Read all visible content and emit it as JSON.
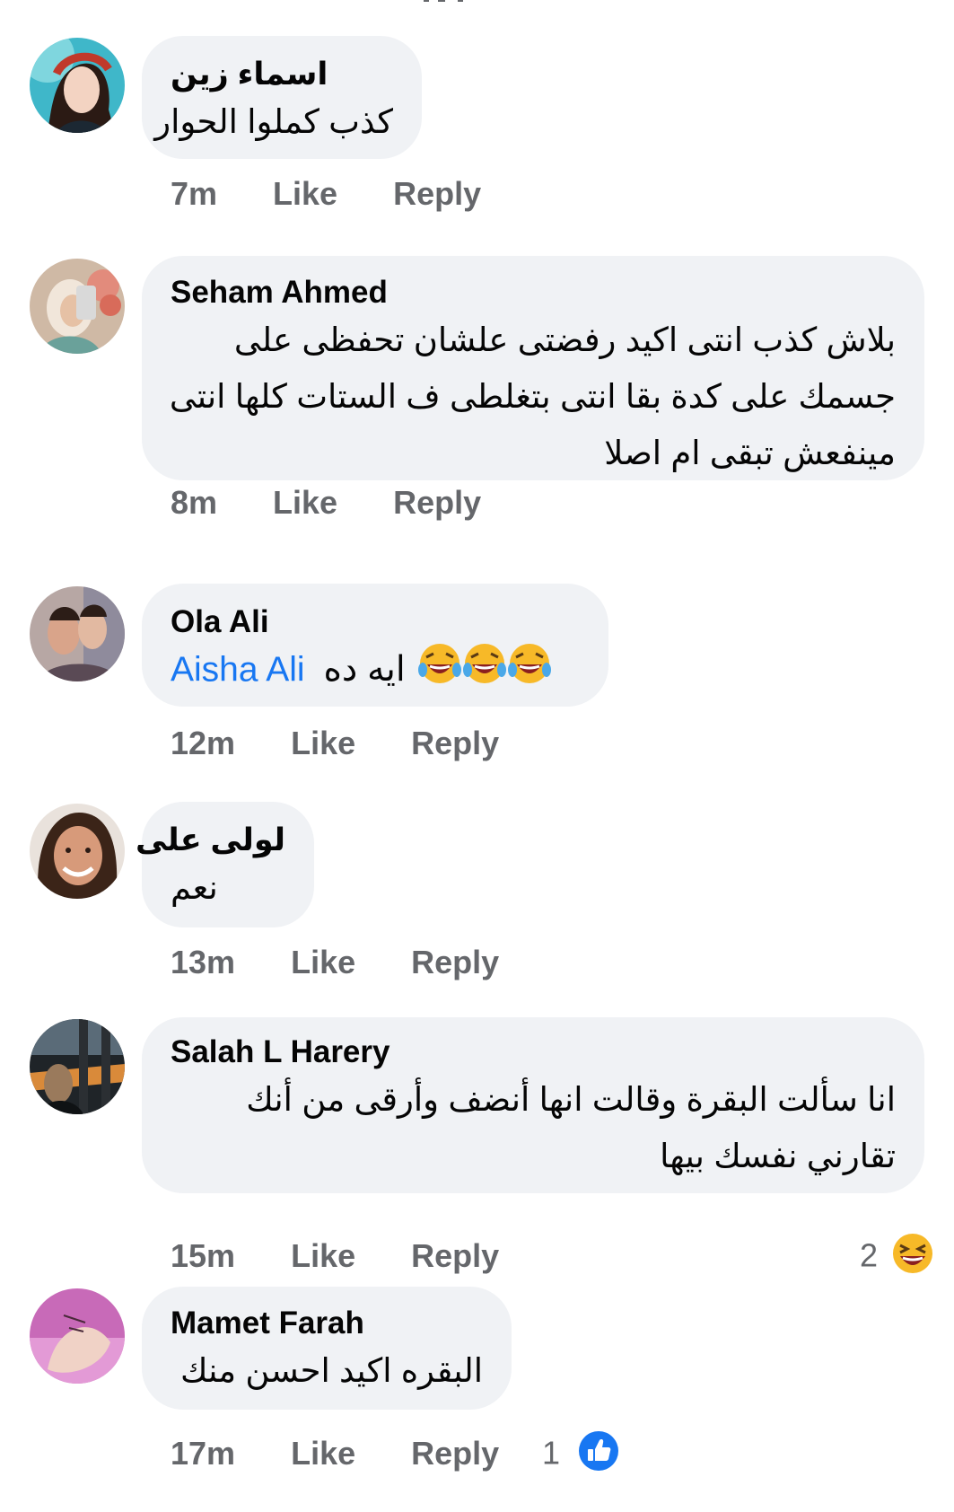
{
  "comments": [
    {
      "author": "اسماء زين",
      "lines": [
        "كذب كملوا الحوار"
      ],
      "time": "7m",
      "like": "Like",
      "reply": "Reply"
    },
    {
      "author": "Seham Ahmed",
      "lines": [
        "بلاش كذب انتى اكيد رفضتى علشان تحفظى على",
        "جسمك على كدة بقا انتى بتغلطى ف الستات كلها انتى",
        "مينفعش تبقى ام اصلا"
      ],
      "time": "8m",
      "like": "Like",
      "reply": "Reply"
    },
    {
      "author": "Ola Ali",
      "mention": "Aisha Ali",
      "text": "ايه ده",
      "emoji": "laughing-tears-emoji",
      "time": "12m",
      "like": "Like",
      "reply": "Reply"
    },
    {
      "author": "لولى على",
      "lines": [
        "نعم"
      ],
      "time": "13m",
      "like": "Like",
      "reply": "Reply"
    },
    {
      "author": "Salah L Harery",
      "lines": [
        "انا سألت البقرة وقالت انها أنضف وأرقى من أنك",
        "تقارني نفسك بيها"
      ],
      "time": "15m",
      "like": "Like",
      "reply": "Reply",
      "reaction_count": "2",
      "reaction_icon": "laughing-face-icon"
    },
    {
      "author": "Mamet Farah",
      "lines": [
        "البقره اكيد احسن منك"
      ],
      "time": "17m",
      "like": "Like",
      "reply": "Reply",
      "reaction_count": "1",
      "reaction_icon": "like-thumb-icon"
    }
  ],
  "colors": {
    "bubble": "#f0f2f5",
    "meta_text": "#65676b",
    "mention": "#1877f2",
    "like_blue": "#1877f2"
  }
}
